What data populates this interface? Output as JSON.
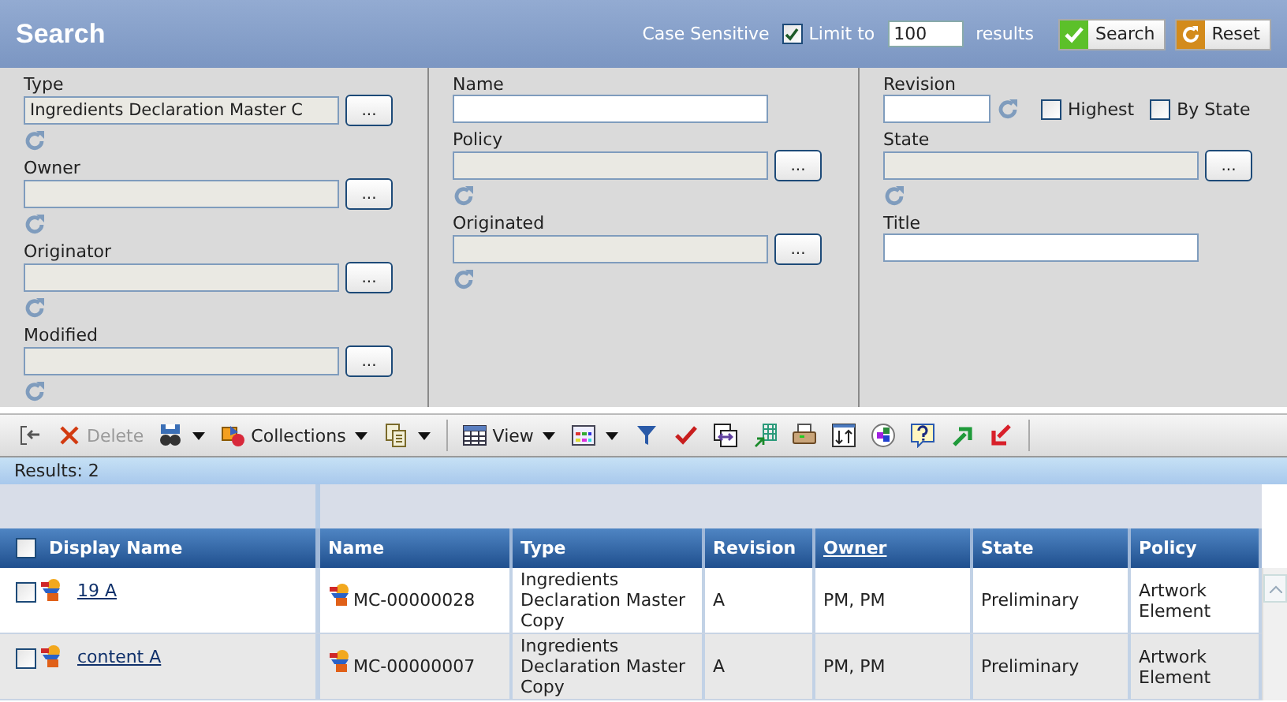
{
  "header": {
    "title": "Search",
    "case_sensitive": "Case Sensitive",
    "limit": {
      "checked": true,
      "label": "Limit to",
      "value": "100",
      "suffix": "results"
    },
    "buttons": [
      {
        "kind": "search",
        "label": "Search"
      },
      {
        "kind": "reset",
        "label": "Reset"
      }
    ]
  },
  "form": {
    "columns": [
      {
        "fields": [
          {
            "label": "Type",
            "kind": "chooser",
            "value": "Ingredients Declaration Master C",
            "button": "..."
          },
          {
            "label": "Owner",
            "kind": "chooser",
            "button": "..."
          },
          {
            "label": "Originator",
            "kind": "chooser",
            "button": "..."
          },
          {
            "label": "Modified",
            "kind": "chooser",
            "button": "..."
          }
        ]
      },
      {
        "fields": [
          {
            "label": "Name",
            "kind": "text"
          },
          {
            "label": "Policy",
            "kind": "chooser",
            "button": "..."
          },
          {
            "label": "Originated",
            "kind": "chooser",
            "button": "..."
          }
        ]
      },
      {
        "fields": [
          {
            "label": "Revision",
            "kind": "revision",
            "options": [
              {
                "label": "Highest",
                "checked": false
              },
              {
                "label": "By State",
                "checked": false
              }
            ]
          },
          {
            "label": "State",
            "kind": "chooser",
            "button": "..."
          },
          {
            "label": "Title",
            "kind": "text"
          }
        ]
      }
    ]
  },
  "toolbar": [
    {
      "kind": "tool",
      "dropdown": false
    },
    {
      "kind": "tool",
      "label": "Delete",
      "disabled": true,
      "dropdown": false
    },
    {
      "kind": "tool",
      "dropdown": true
    },
    {
      "kind": "tool",
      "label": "Collections",
      "dropdown": true
    },
    {
      "kind": "tool",
      "dropdown": true
    },
    {
      "kind": "separator"
    },
    {
      "kind": "tool",
      "label": "View",
      "dropdown": true
    },
    {
      "kind": "tool",
      "dropdown": true
    },
    {
      "kind": "tool",
      "dropdown": false
    },
    {
      "kind": "tool",
      "dropdown": false
    },
    {
      "kind": "tool",
      "dropdown": false
    },
    {
      "kind": "tool",
      "dropdown": false
    },
    {
      "kind": "tool",
      "dropdown": false
    },
    {
      "kind": "tool",
      "dropdown": false
    },
    {
      "kind": "tool",
      "dropdown": false
    },
    {
      "kind": "tool",
      "dropdown": false
    },
    {
      "kind": "tool",
      "dropdown": false
    },
    {
      "kind": "tool",
      "dropdown": false
    },
    {
      "kind": "separator"
    }
  ],
  "results": "Results: 2",
  "table": {
    "select_all": false,
    "columns": [
      {
        "label": "Display Name",
        "sorted": false
      },
      {
        "label": "Name",
        "sorted": false
      },
      {
        "label": "Type",
        "sorted": false
      },
      {
        "label": "Revision",
        "sorted": false
      },
      {
        "label": "Owner",
        "sorted": true
      },
      {
        "label": "State",
        "sorted": false
      },
      {
        "label": "Policy",
        "sorted": false
      }
    ],
    "rows": [
      {
        "checked": false,
        "display_name": "19 A",
        "name": "MC-00000028",
        "type": "Ingredients Declaration Master Copy",
        "revision": "A",
        "owner": "PM, PM",
        "state": "Preliminary",
        "policy": "Artwork Element"
      },
      {
        "checked": false,
        "display_name": "content A",
        "name": "MC-00000007",
        "type": "Ingredients Declaration Master Copy",
        "revision": "A",
        "owner": "PM, PM",
        "state": "Preliminary",
        "policy": "Artwork Element"
      }
    ]
  }
}
